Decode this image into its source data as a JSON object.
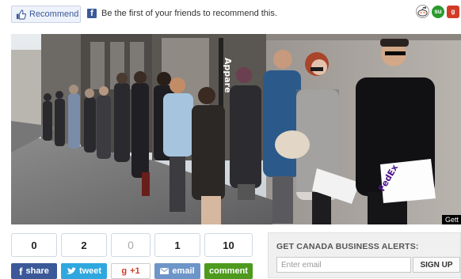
{
  "top_bar": {
    "recommend_label": "Recommend",
    "recommend_message": "Be the first of your friends to recommend this.",
    "social_icons": [
      "reddit-icon",
      "stumbleupon-icon",
      "google-icon"
    ]
  },
  "photo": {
    "sign_text": "Appare",
    "bag_text": "FedEx",
    "credit": "Gett"
  },
  "share_counts": [
    {
      "network": "facebook",
      "count": "0",
      "label": "share"
    },
    {
      "network": "twitter",
      "count": "2",
      "label": "tweet"
    },
    {
      "network": "google-plus",
      "count": "0",
      "label": "+1"
    },
    {
      "network": "email",
      "count": "1",
      "label": "email"
    },
    {
      "network": "comments",
      "count": "10",
      "label": "comment"
    }
  ],
  "alerts": {
    "title": "GET CANADA BUSINESS ALERTS:",
    "email_placeholder": "Enter email",
    "signup_label": "SIGN UP"
  },
  "colors": {
    "facebook": "#3b5998",
    "twitter": "#2fa8df",
    "google": "#d23b28",
    "email": "#6e95c8",
    "comment": "#4d9a1e"
  }
}
